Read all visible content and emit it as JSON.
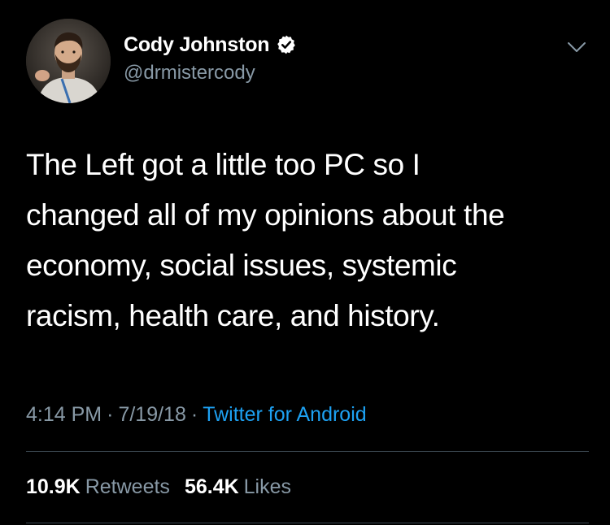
{
  "colors": {
    "background": "#000000",
    "primary_text": "#ffffff",
    "secondary_text": "#8899a6",
    "accent": "#1da1f2",
    "divider": "#38444d"
  },
  "author": {
    "display_name": "Cody Johnston",
    "handle": "@drmistercody",
    "verified": true,
    "avatar_icon": "avatar-portrait"
  },
  "tweet": {
    "text": "The Left got a little too PC so I\nchanged all of my opinions about the\neconomy, social issues, systemic\nracism, health care, and history."
  },
  "meta": {
    "time": "4:14 PM",
    "separator": "·",
    "date": "7/19/18",
    "source": "Twitter for Android"
  },
  "stats": {
    "retweets_count": "10.9K",
    "retweets_label": "Retweets",
    "likes_count": "56.4K",
    "likes_label": "Likes"
  },
  "icons": {
    "verified": "verified-badge-icon",
    "menu": "chevron-down-icon"
  }
}
